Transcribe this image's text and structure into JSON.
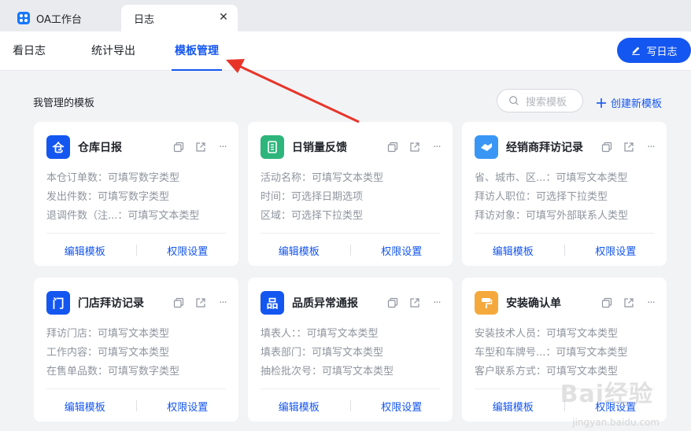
{
  "window_tabs": [
    {
      "label": "OA工作台"
    },
    {
      "label": "日志"
    }
  ],
  "tab_close": "✕",
  "subtabs": [
    {
      "label": "看日志"
    },
    {
      "label": "统计导出"
    },
    {
      "label": "模板管理",
      "active": true
    }
  ],
  "write_button": "写日志",
  "section_title": "我管理的模板",
  "search": {
    "placeholder": "搜索模板"
  },
  "create_button": "创建新模板",
  "actions": {
    "edit": "编辑模板",
    "permission": "权限设置"
  },
  "more_icon": "···",
  "cards": [
    {
      "title": "仓库日报",
      "icon_text": "仓",
      "icon": "warehouse-icon",
      "icon_color": "#1456f0",
      "fields": [
        "本仓订单数：可填写数字类型",
        "发出件数：可填写数字类型",
        "退调件数（注...：可填写文本类型"
      ]
    },
    {
      "title": "日销量反馈",
      "icon_text": "",
      "icon": "sales-icon",
      "icon_color": "#2db57c",
      "fields": [
        "活动名称：可填写文本类型",
        "时间：可选择日期选项",
        "区域：可选择下拉类型"
      ]
    },
    {
      "title": "经销商拜访记录",
      "icon_text": "",
      "icon": "handshake-icon",
      "icon_color": "#3a96f5",
      "fields": [
        "省、城市、区...：可填写文本类型",
        "拜访人职位：可选择下拉类型",
        "拜访对象：可填写外部联系人类型"
      ]
    },
    {
      "title": "门店拜访记录",
      "icon_text": "门",
      "icon": "store-icon",
      "icon_color": "#1456f0",
      "fields": [
        "拜访门店：可填写文本类型",
        "工作内容：可填写文本类型",
        "在售单品数：可填写数字类型"
      ]
    },
    {
      "title": "品质异常通报",
      "icon_text": "品",
      "icon": "quality-icon",
      "icon_color": "#1456f0",
      "fields": [
        "填表人：：可填写文本类型",
        "填表部门：可填写文本类型",
        "抽检批次号：可填写文本类型"
      ]
    },
    {
      "title": "安装确认单",
      "icon_text": "",
      "icon": "paint-roller-icon",
      "icon_color": "#f5a93c",
      "fields": [
        "安装技术人员：可填写文本类型",
        "车型和车牌号...：可填写文本类型",
        "客户联系方式：可填写文本类型"
      ]
    }
  ],
  "watermark": {
    "text": "Bai经验",
    "sub": "jingyan.baidu.com"
  },
  "annotation_color": "#e8352a"
}
